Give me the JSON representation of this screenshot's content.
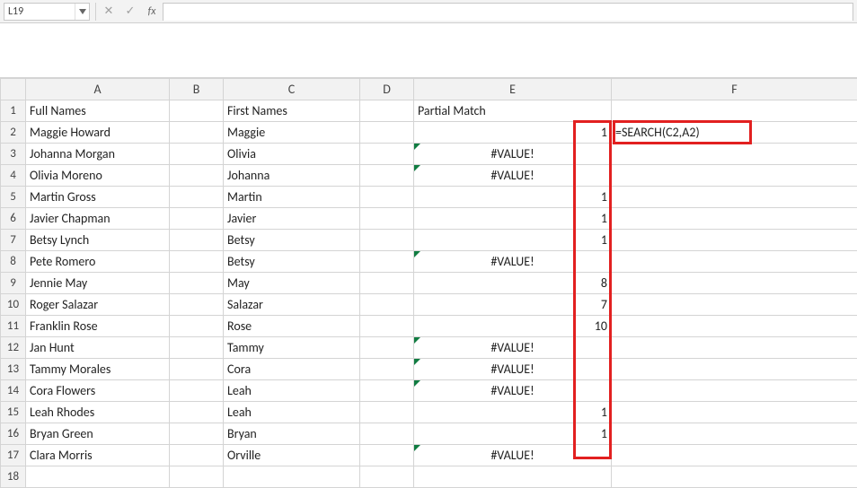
{
  "namebox_value": "L19",
  "formula_bar_value": "",
  "fx_label": "fx",
  "columns": [
    "A",
    "B",
    "C",
    "D",
    "E",
    "F"
  ],
  "row_numbers": [
    1,
    2,
    3,
    4,
    5,
    6,
    7,
    8,
    9,
    10,
    11,
    12,
    13,
    14,
    15,
    16,
    17,
    18
  ],
  "headers": {
    "A": "Full Names",
    "C": "First Names",
    "E": "Partial Match"
  },
  "f2_formula": "=SEARCH(C2,A2)",
  "rows": [
    {
      "A": "Maggie Howard",
      "C": "Maggie",
      "E": "1",
      "E_err": false
    },
    {
      "A": "Johanna Morgan",
      "C": "Olivia",
      "E": "#VALUE!",
      "E_err": true
    },
    {
      "A": "Olivia Moreno",
      "C": "Johanna",
      "E": "#VALUE!",
      "E_err": true
    },
    {
      "A": "Martin Gross",
      "C": "Martin",
      "E": "1",
      "E_err": false
    },
    {
      "A": "Javier Chapman",
      "C": "Javier",
      "E": "1",
      "E_err": false
    },
    {
      "A": "Betsy Lynch",
      "C": "Betsy",
      "E": "1",
      "E_err": false
    },
    {
      "A": "Pete Romero",
      "C": "Betsy",
      "E": "#VALUE!",
      "E_err": true
    },
    {
      "A": "Jennie May",
      "C": "May",
      "E": "8",
      "E_err": false
    },
    {
      "A": "Roger Salazar",
      "C": "Salazar",
      "E": "7",
      "E_err": false
    },
    {
      "A": "Franklin Rose",
      "C": "Rose",
      "E": "10",
      "E_err": false
    },
    {
      "A": "Jan Hunt",
      "C": "Tammy",
      "E": "#VALUE!",
      "E_err": true
    },
    {
      "A": "Tammy Morales",
      "C": "Cora",
      "E": "#VALUE!",
      "E_err": true
    },
    {
      "A": "Cora Flowers",
      "C": "Leah",
      "E": "#VALUE!",
      "E_err": true
    },
    {
      "A": "Leah Rhodes",
      "C": "Leah",
      "E": "1",
      "E_err": false
    },
    {
      "A": "Bryan Green",
      "C": "Bryan",
      "E": "1",
      "E_err": false
    },
    {
      "A": "Clara Morris",
      "C": "Orville",
      "E": "#VALUE!",
      "E_err": true
    }
  ]
}
